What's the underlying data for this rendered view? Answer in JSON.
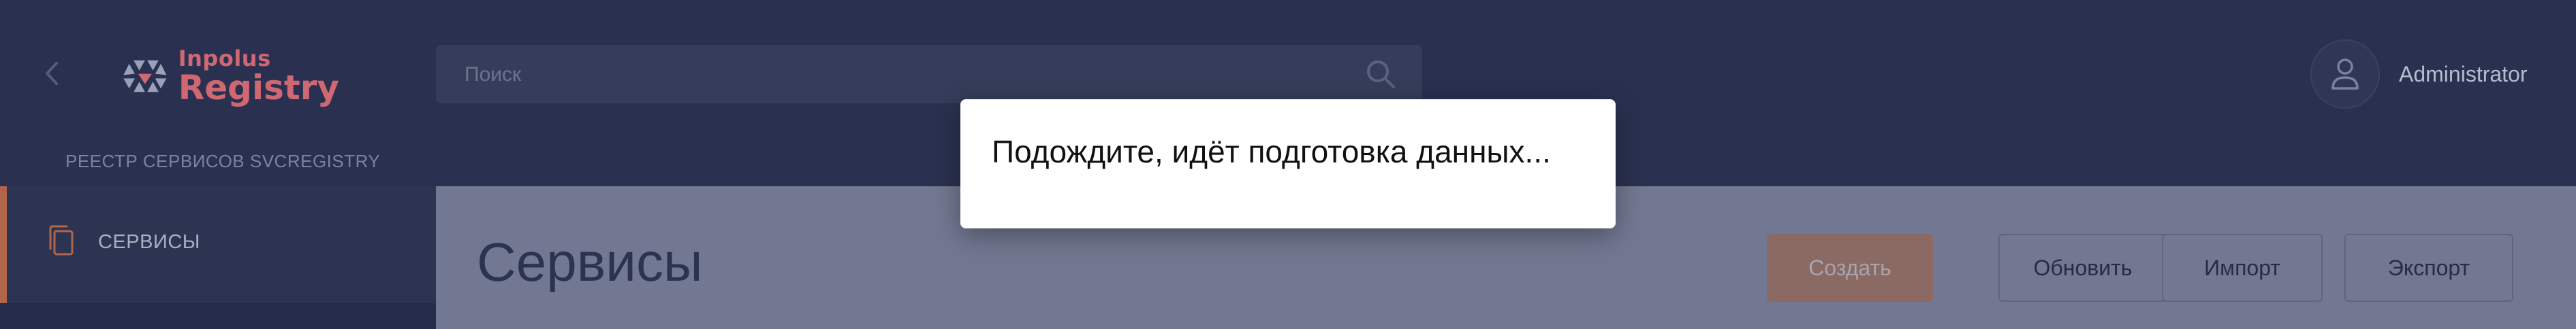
{
  "header": {
    "logo": {
      "small": "Inpolus",
      "big": "Registry"
    },
    "search": {
      "placeholder": "Поиск",
      "value": ""
    },
    "user": {
      "name": "Administrator"
    }
  },
  "breadcrumb": "РЕЕСТР СЕРВИСОВ SVCREGISTRY",
  "sidebar": {
    "items": [
      {
        "label": "СЕРВИСЫ",
        "icon": "document-copy-icon",
        "active": true
      }
    ]
  },
  "main": {
    "title": "Сервисы",
    "buttons": {
      "create": "Создать",
      "refresh": "Обновить",
      "import": "Импорт",
      "export": "Экспорт"
    }
  },
  "modal": {
    "message": "Подождите, идёт подготовка данных..."
  },
  "colors": {
    "header_bg": "#2a3150",
    "accent": "#b3654c",
    "brand": "#d06874",
    "overlay_main": "#727891"
  }
}
